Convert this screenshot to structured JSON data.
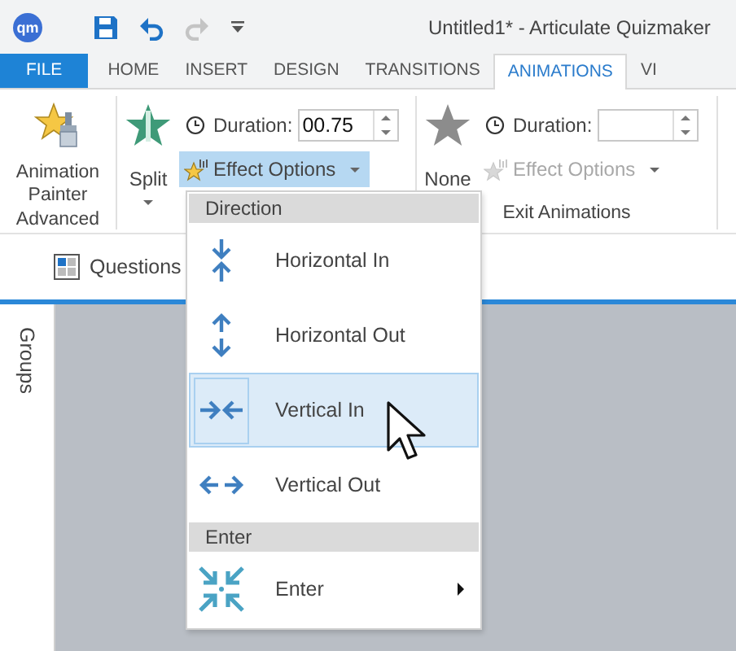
{
  "title_bar": {
    "logo": "qm",
    "title": "Untitled1* -  Articulate Quizmaker"
  },
  "tabs": [
    {
      "label": "FILE",
      "kind": "file",
      "selected": false
    },
    {
      "label": "HOME",
      "kind": "tab",
      "selected": false
    },
    {
      "label": "INSERT",
      "kind": "tab",
      "selected": false
    },
    {
      "label": "DESIGN",
      "kind": "tab",
      "selected": false
    },
    {
      "label": "TRANSITIONS",
      "kind": "tab",
      "selected": false
    },
    {
      "label": "ANIMATIONS",
      "kind": "tab",
      "selected": true
    },
    {
      "label": "VI",
      "kind": "tab",
      "selected": false
    }
  ],
  "ribbon": {
    "advanced": {
      "button": "Animation Painter",
      "label": "Advanced"
    },
    "animation_groups": [
      {
        "effect": "Split",
        "kind": "split",
        "has_caret": true,
        "duration_label": "Duration:",
        "duration": "00.75",
        "effect_options": {
          "label": "Effect Options",
          "disabled": false,
          "open": true
        }
      },
      {
        "effect": "None",
        "kind": "none",
        "has_caret": false,
        "duration_label": "Duration:",
        "effect_options": {
          "label": "Effect Options",
          "disabled": true,
          "open": false
        },
        "label": "Exit Animations"
      }
    ]
  },
  "view_bar": {
    "button": "Questions"
  },
  "groups_panel": {
    "title": "Groups"
  },
  "effect_menu": {
    "sections": [
      {
        "title": "Direction",
        "items": [
          {
            "label": "Horizontal In",
            "kind": "horizontal-in",
            "selected": false,
            "has_submenu": false
          },
          {
            "label": "Horizontal Out",
            "kind": "horizontal-out",
            "selected": false,
            "has_submenu": false
          },
          {
            "label": "Vertical In",
            "kind": "vertical-in",
            "selected": true,
            "has_submenu": false
          },
          {
            "label": "Vertical Out",
            "kind": "vertical-out",
            "selected": false,
            "has_submenu": false
          }
        ]
      },
      {
        "title": "Enter",
        "items": [
          {
            "label": "Enter",
            "kind": "enter",
            "selected": false,
            "has_submenu": true
          }
        ]
      }
    ]
  }
}
